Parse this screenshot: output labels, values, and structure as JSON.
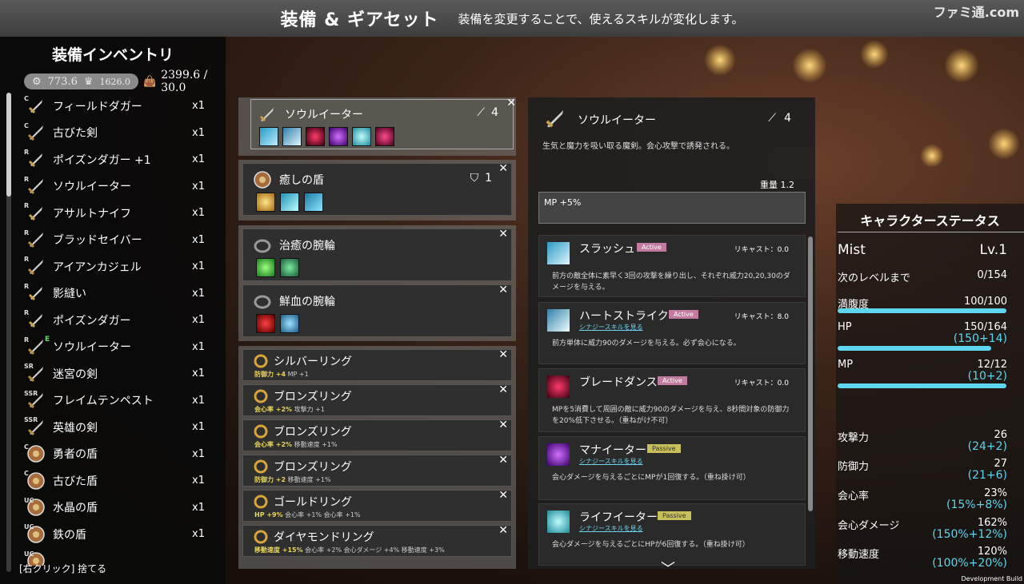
{
  "header": {
    "title": "装備 & ギアセット",
    "subtitle": "装備を変更することで、使えるスキルが変化します。",
    "watermark": "ファミ通.com"
  },
  "inventory": {
    "title": "装備インベントリ",
    "stat1": "773.6",
    "stat2": "1626.0",
    "weight": "2399.6 / 30.0",
    "discard_hint": "[右クリック] 捨てる",
    "items": [
      {
        "rarity": "C",
        "name": "フィールドダガー",
        "qty": "x1",
        "icon": "dagger-icon"
      },
      {
        "rarity": "C",
        "name": "古びた剣",
        "qty": "x1",
        "icon": "sword-icon"
      },
      {
        "rarity": "R",
        "name": "ポイズンダガー +1",
        "qty": "x1",
        "icon": "dagger-icon"
      },
      {
        "rarity": "R",
        "name": "ソウルイーター",
        "qty": "x1",
        "icon": "sword-icon"
      },
      {
        "rarity": "R",
        "name": "アサルトナイフ",
        "qty": "x1",
        "icon": "dagger-icon"
      },
      {
        "rarity": "R",
        "name": "ブラッドセイバー",
        "qty": "x1",
        "icon": "sword-icon"
      },
      {
        "rarity": "R",
        "name": "アイアンカジェル",
        "qty": "x1",
        "icon": "sword-icon"
      },
      {
        "rarity": "R",
        "name": "影縫い",
        "qty": "x1",
        "icon": "dagger-icon"
      },
      {
        "rarity": "R",
        "name": "ポイズンダガー",
        "qty": "x1",
        "icon": "dagger-icon"
      },
      {
        "rarity": "R",
        "name": "ソウルイーター",
        "qty": "x1",
        "icon": "sword-icon",
        "equipped": "E"
      },
      {
        "rarity": "SR",
        "name": "迷宮の剣",
        "qty": "x1",
        "icon": "sword-icon"
      },
      {
        "rarity": "SSR",
        "name": "フレイムテンペスト",
        "qty": "x1",
        "icon": "sword-icon"
      },
      {
        "rarity": "SSR",
        "name": "英雄の剣",
        "qty": "x1",
        "icon": "sword-icon"
      },
      {
        "rarity": "C",
        "name": "勇者の盾",
        "qty": "x1",
        "icon": "shield-icon"
      },
      {
        "rarity": "C",
        "name": "古びた盾",
        "qty": "x1",
        "icon": "shield-icon"
      },
      {
        "rarity": "UC",
        "name": "水晶の盾",
        "qty": "x1",
        "icon": "shield-icon"
      },
      {
        "rarity": "UC",
        "name": "鉄の盾",
        "qty": "x1",
        "icon": "shield-icon"
      },
      {
        "rarity": "UC",
        "name": "",
        "qty": "",
        "icon": "shield-icon"
      }
    ]
  },
  "equipment": {
    "weapon": {
      "name": "ソウルイーター",
      "level": "4",
      "close": "✕"
    },
    "shield": {
      "name": "癒しの盾",
      "level": "1",
      "close": "✕"
    },
    "bracelet1": {
      "name": "治癒の腕輪",
      "close": "✕"
    },
    "bracelet2": {
      "name": "鮮血の腕輪",
      "close": "✕"
    },
    "rings": [
      {
        "name": "シルバーリング",
        "stat_key": "防御力 +4",
        "stat_rest": " MP +1"
      },
      {
        "name": "ブロンズリング",
        "stat_key": "会心率 +2%",
        "stat_rest": " 攻撃力 +1"
      },
      {
        "name": "ブロンズリング",
        "stat_key": "会心率 +2%",
        "stat_rest": " 移動速度 +1%"
      },
      {
        "name": "ブロンズリング",
        "stat_key": "防御力 +2",
        "stat_rest": " 移動速度 +1%"
      },
      {
        "name": "ゴールドリング",
        "stat_key": "HP +9%",
        "stat_rest": " 会心率 +1%  会心率 +1%"
      },
      {
        "name": "ダイヤモンドリング",
        "stat_key": "移動速度 +15%",
        "stat_rest": " 会心率 +2%  会心ダメージ +4%  移動速度 +3%"
      }
    ]
  },
  "detail": {
    "name": "ソウルイーター",
    "level": "4",
    "description": "生気と魔力を吸い取る魔剣。会心攻撃で誘発される。",
    "weight_label": "重量  1.2",
    "bonus": "MP +5%",
    "skills": [
      {
        "name": "スラッシュ",
        "tag": "Active",
        "recast": "リキャスト：0.0",
        "link": "",
        "desc": "前方の敵全体に素早く3回の攻撃を繰り出し、それぞれ威力20,20,30のダメージを与える。"
      },
      {
        "name": "ハートストライク",
        "tag": "Active",
        "recast": "リキャスト：8.0",
        "link": "シナジースキルを見る",
        "desc": "前方単体に威力90のダメージを与える。必ず会心になる。"
      },
      {
        "name": "ブレードダンス",
        "tag": "Active",
        "recast": "リキャスト：0.0",
        "link": "",
        "desc": "MPを5消費して周囲の敵に威力90のダメージを与え、8秒間対象の防御力を20%低下させる。（重ねがけ不可）"
      },
      {
        "name": "マナイーター",
        "tag": "Passive",
        "recast": "",
        "link": "シナジースキルを見る",
        "desc": "会心ダメージを与えるごとにMPが1回復する。（重ね掛け可）"
      },
      {
        "name": "ライフイーター",
        "tag": "Passive",
        "recast": "",
        "link": "シナジースキルを見る",
        "desc": "会心ダメージを与えるごとにHPが6回復する。（重ね掛け可）"
      }
    ]
  },
  "status": {
    "title": "キャラクターステータス",
    "name": "Mist",
    "level": "Lv.1",
    "rows": {
      "next_level": {
        "label": "次のレベルまで",
        "value": "0/154"
      },
      "satiety": {
        "label": "満腹度",
        "value": "100/100"
      },
      "hp": {
        "label": "HP",
        "value": "150/164",
        "sub": "(150+14)"
      },
      "mp": {
        "label": "MP",
        "value": "12/12",
        "sub": "(10+2)"
      },
      "attack": {
        "label": "攻撃力",
        "value": "26",
        "sub": "(24+2)"
      },
      "defense": {
        "label": "防御力",
        "value": "27",
        "sub": "(21+6)"
      },
      "crit_rate": {
        "label": "会心率",
        "value": "23%",
        "sub": "(15%+8%)"
      },
      "crit_dmg": {
        "label": "会心ダメージ",
        "value": "162%",
        "sub": "(150%+12%)"
      },
      "move_speed": {
        "label": "移動速度",
        "value": "120%",
        "sub": "(100%+20%)"
      }
    },
    "satiety_fill": 1.0,
    "hp_fill": 0.91,
    "mp_fill": 1.0
  },
  "footer": {
    "build": "Development Build"
  },
  "colors": {
    "accent": "#5fd6ef",
    "active_tag": "#c27aa0",
    "passive_tag": "#c7bf5a",
    "equipped": "#5fe36b"
  }
}
